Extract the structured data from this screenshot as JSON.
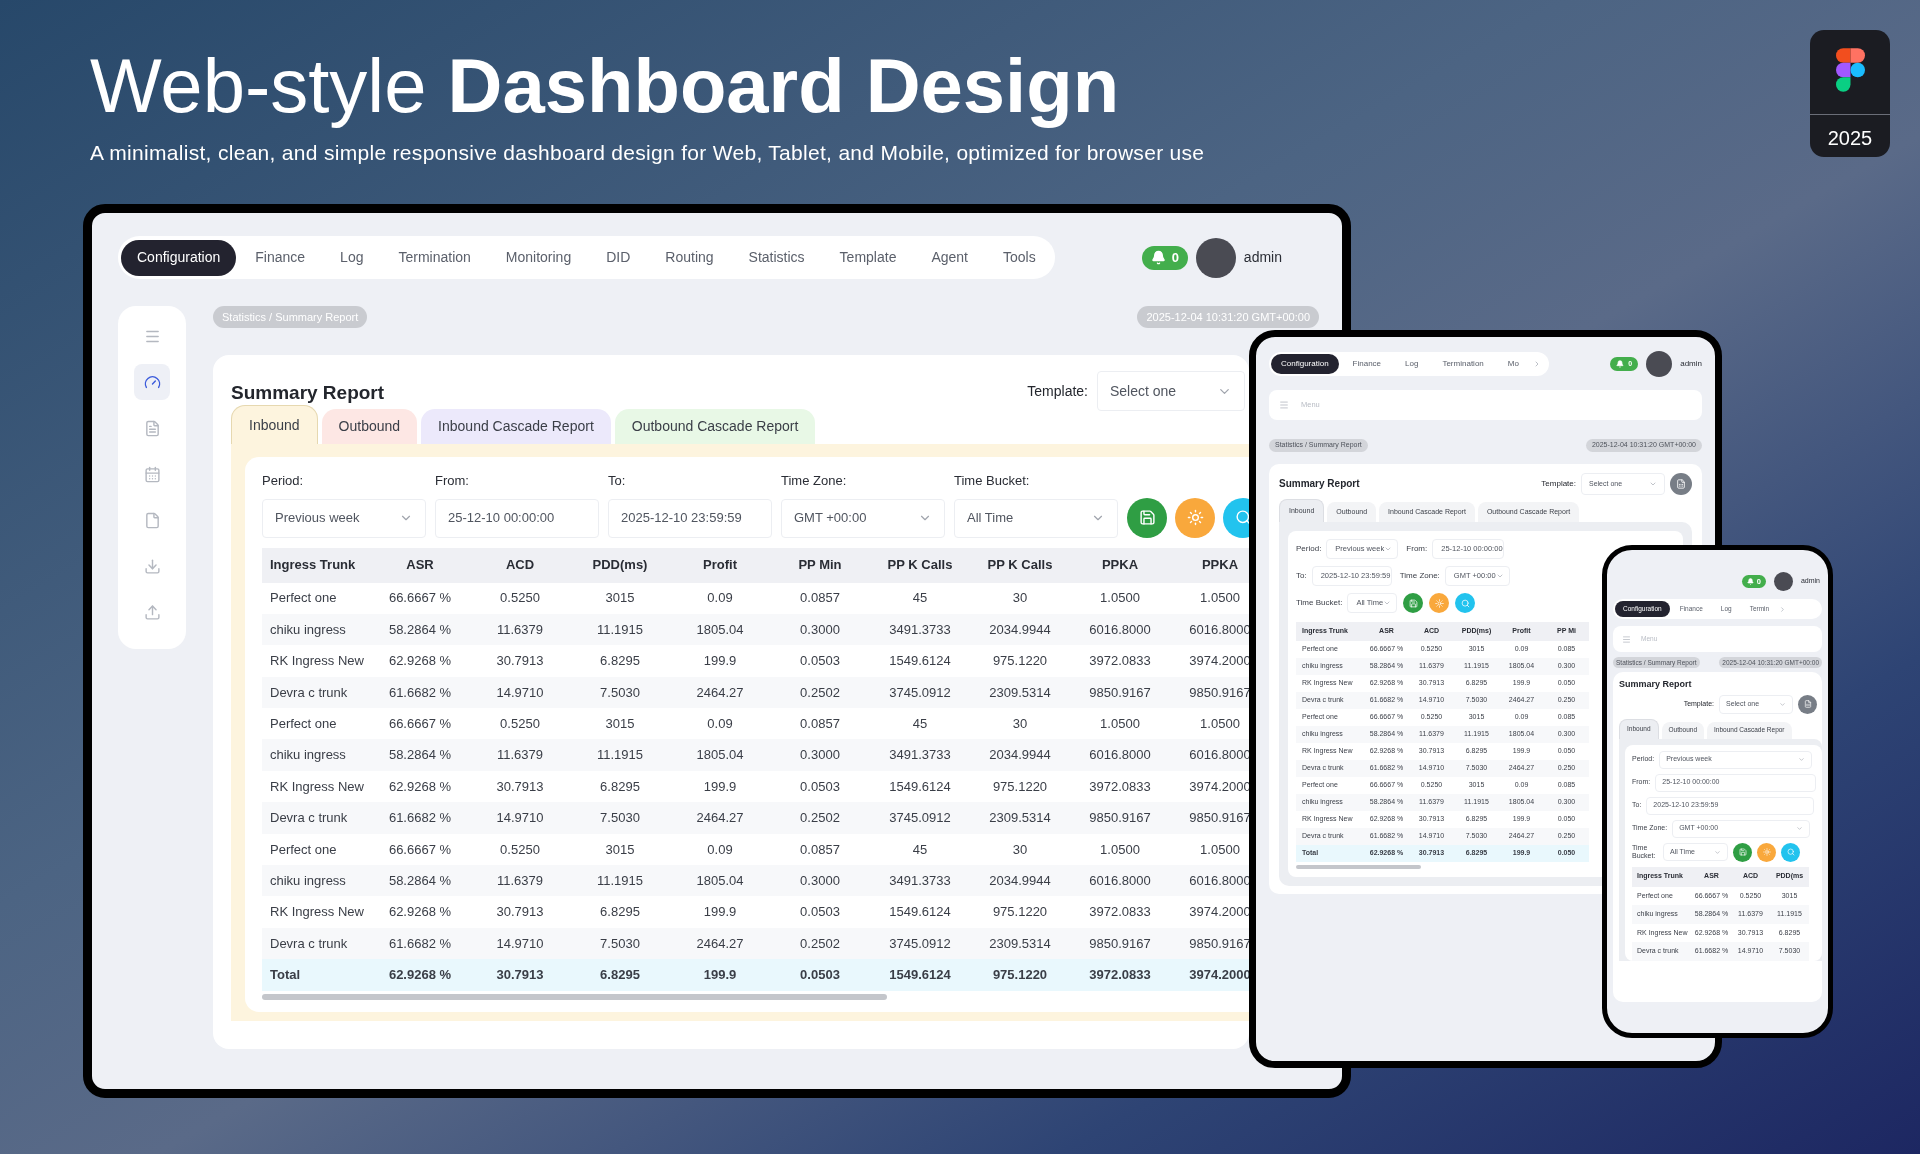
{
  "header": {
    "title_light": "Web-style",
    "title_bold": "Dashboard Design",
    "subtitle": "A minimalist, clean, and simple responsive dashboard design for Web, Tablet, and Mobile, optimized for browser use"
  },
  "badge": {
    "year": "2025"
  },
  "desktop": {
    "nav": {
      "items": [
        {
          "label": "Configuration",
          "selected": true
        },
        {
          "label": "Finance",
          "selected": false
        },
        {
          "label": "Log",
          "selected": false
        },
        {
          "label": "Termination",
          "selected": false
        },
        {
          "label": "Monitoring",
          "selected": false
        },
        {
          "label": "DID",
          "selected": false
        },
        {
          "label": "Routing",
          "selected": false
        },
        {
          "label": "Statistics",
          "selected": false
        },
        {
          "label": "Template",
          "selected": false
        },
        {
          "label": "Agent",
          "selected": false
        },
        {
          "label": "Tools",
          "selected": false
        }
      ]
    },
    "notifications": "0",
    "user": "admin",
    "sidebar": [
      {
        "kind": "menu",
        "selected": false
      },
      {
        "kind": "dashboard",
        "selected": true
      },
      {
        "kind": "report",
        "selected": false
      },
      {
        "kind": "calendar",
        "selected": false
      },
      {
        "kind": "document",
        "selected": false
      },
      {
        "kind": "download",
        "selected": false
      },
      {
        "kind": "upload",
        "selected": false
      }
    ],
    "breadcrumb": "Statistics / Summary Report",
    "timestamp": "2025-12-04 10:31:20 GMT+00:00",
    "report": {
      "title": "Summary Report",
      "template_label": "Template:",
      "template_select": "Select one",
      "tabs": [
        {
          "label": "Inbound",
          "selected": true,
          "color": "#fdf4de"
        },
        {
          "label": "Outbound",
          "selected": false,
          "color": "#fde7e4"
        },
        {
          "label": "Inbound Cascade Report",
          "selected": false,
          "color": "#ece9fb"
        },
        {
          "label": "Outbound Cascade Report",
          "selected": false,
          "color": "#e8f8e6"
        }
      ],
      "filters": [
        {
          "label": "Period:",
          "value": "Previous week",
          "kind": "select"
        },
        {
          "label": "From:",
          "value": "25-12-10 00:00:00",
          "kind": "input"
        },
        {
          "label": "To:",
          "value": "2025-12-10 23:59:59",
          "kind": "input"
        },
        {
          "label": "Time Zone:",
          "value": "GMT +00:00",
          "kind": "select"
        },
        {
          "label": "Time Bucket:",
          "value": "All Time",
          "kind": "select"
        }
      ],
      "actions": [
        {
          "kind": "save",
          "color": "#2f9e44"
        },
        {
          "kind": "brightness",
          "color": "#f9a83c"
        },
        {
          "kind": "search",
          "color": "#22c3ee"
        }
      ],
      "table": {
        "columns": [
          "Ingress Trunk",
          "ASR",
          "ACD",
          "PDD(ms)",
          "Profit",
          "PP Min",
          "PP K Calls",
          "PP K Calls",
          "PPKA",
          "PPKA"
        ],
        "rows": [
          [
            "Perfect one",
            "66.6667 %",
            "0.5250",
            "3015",
            "0.09",
            "0.0857",
            "45",
            "30",
            "1.0500",
            "1.0500"
          ],
          [
            "chiku ingress",
            "58.2864 %",
            "11.6379",
            "11.1915",
            "1805.04",
            "0.3000",
            "3491.3733",
            "2034.9944",
            "6016.8000",
            "6016.8000"
          ],
          [
            "RK Ingress New",
            "62.9268 %",
            "30.7913",
            "6.8295",
            "199.9",
            "0.0503",
            "1549.6124",
            "975.1220",
            "3972.0833",
            "3974.2000"
          ],
          [
            "Devra c trunk",
            "61.6682 %",
            "14.9710",
            "7.5030",
            "2464.27",
            "0.2502",
            "3745.0912",
            "2309.5314",
            "9850.9167",
            "9850.9167"
          ],
          [
            "Perfect one",
            "66.6667 %",
            "0.5250",
            "3015",
            "0.09",
            "0.0857",
            "45",
            "30",
            "1.0500",
            "1.0500"
          ],
          [
            "chiku ingress",
            "58.2864 %",
            "11.6379",
            "11.1915",
            "1805.04",
            "0.3000",
            "3491.3733",
            "2034.9944",
            "6016.8000",
            "6016.8000"
          ],
          [
            "RK Ingress New",
            "62.9268 %",
            "30.7913",
            "6.8295",
            "199.9",
            "0.0503",
            "1549.6124",
            "975.1220",
            "3972.0833",
            "3974.2000"
          ],
          [
            "Devra c trunk",
            "61.6682 %",
            "14.9710",
            "7.5030",
            "2464.27",
            "0.2502",
            "3745.0912",
            "2309.5314",
            "9850.9167",
            "9850.9167"
          ],
          [
            "Perfect one",
            "66.6667 %",
            "0.5250",
            "3015",
            "0.09",
            "0.0857",
            "45",
            "30",
            "1.0500",
            "1.0500"
          ],
          [
            "chiku ingress",
            "58.2864 %",
            "11.6379",
            "11.1915",
            "1805.04",
            "0.3000",
            "3491.3733",
            "2034.9944",
            "6016.8000",
            "6016.8000"
          ],
          [
            "RK Ingress New",
            "62.9268 %",
            "30.7913",
            "6.8295",
            "199.9",
            "0.0503",
            "1549.6124",
            "975.1220",
            "3972.0833",
            "3974.2000"
          ],
          [
            "Devra c trunk",
            "61.6682 %",
            "14.9710",
            "7.5030",
            "2464.27",
            "0.2502",
            "3745.0912",
            "2309.5314",
            "9850.9167",
            "9850.9167"
          ]
        ],
        "total": [
          "Total",
          "62.9268 %",
          "30.7913",
          "6.8295",
          "199.9",
          "0.0503",
          "1549.6124",
          "975.1220",
          "3972.0833",
          "3974.2000"
        ]
      }
    }
  },
  "tablet": {
    "nav": {
      "items": [
        {
          "label": "Configuration",
          "selected": true
        },
        {
          "label": "Finance",
          "selected": false
        },
        {
          "label": "Log",
          "selected": false
        },
        {
          "label": "Termination",
          "selected": false
        },
        {
          "label": "Mo",
          "selected": false
        }
      ],
      "more": true
    },
    "notifications": "0",
    "user": "admin",
    "menu": "Menu",
    "breadcrumb": "Statistics / Summary Report",
    "timestamp": "2025-12-04 10:31:20 GMT+00:00",
    "report": {
      "title": "Summary Report",
      "template_label": "Template:",
      "template_select": "Select one",
      "export": true,
      "tabs": [
        {
          "label": "Inbound",
          "selected": true
        },
        {
          "label": "Outbound",
          "selected": false
        },
        {
          "label": "Inbound Cascade Report",
          "selected": false
        },
        {
          "label": "Outbound Cascade Report",
          "selected": false
        }
      ],
      "filters": [
        {
          "label": "Period:",
          "value": "Previous week",
          "kind": "select"
        },
        {
          "label": "From:",
          "value": "25-12-10 00:00:00",
          "kind": "input"
        },
        {
          "label": "To:",
          "value": "2025-12-10 23:59:59",
          "kind": "input"
        },
        {
          "label": "Time Zone:",
          "value": "GMT +00:00",
          "kind": "select"
        },
        {
          "label": "Time Bucket:",
          "value": "All Time",
          "kind": "select"
        }
      ],
      "actions": [
        {
          "kind": "save",
          "color": "#2f9e44"
        },
        {
          "kind": "brightness",
          "color": "#f9a83c"
        },
        {
          "kind": "search",
          "color": "#22c3ee"
        }
      ],
      "table": {
        "columns": [
          "Ingress Trunk",
          "ASR",
          "ACD",
          "PDD(ms)",
          "Profit",
          "PP Mi"
        ],
        "rows": [
          [
            "Perfect one",
            "66.6667 %",
            "0.5250",
            "3015",
            "0.09",
            "0.085"
          ],
          [
            "chiku ingress",
            "58.2864 %",
            "11.6379",
            "11.1915",
            "1805.04",
            "0.300"
          ],
          [
            "RK Ingress New",
            "62.9268 %",
            "30.7913",
            "6.8295",
            "199.9",
            "0.050"
          ],
          [
            "Devra c trunk",
            "61.6682 %",
            "14.9710",
            "7.5030",
            "2464.27",
            "0.250"
          ],
          [
            "Perfect one",
            "66.6667 %",
            "0.5250",
            "3015",
            "0.09",
            "0.085"
          ],
          [
            "chiku ingress",
            "58.2864 %",
            "11.6379",
            "11.1915",
            "1805.04",
            "0.300"
          ],
          [
            "RK Ingress New",
            "62.9268 %",
            "30.7913",
            "6.8295",
            "199.9",
            "0.050"
          ],
          [
            "Devra c trunk",
            "61.6682 %",
            "14.9710",
            "7.5030",
            "2464.27",
            "0.250"
          ],
          [
            "Perfect one",
            "66.6667 %",
            "0.5250",
            "3015",
            "0.09",
            "0.085"
          ],
          [
            "chiku ingress",
            "58.2864 %",
            "11.6379",
            "11.1915",
            "1805.04",
            "0.300"
          ],
          [
            "RK Ingress New",
            "62.9268 %",
            "30.7913",
            "6.8295",
            "199.9",
            "0.050"
          ],
          [
            "Devra c trunk",
            "61.6682 %",
            "14.9710",
            "7.5030",
            "2464.27",
            "0.250"
          ]
        ],
        "total": [
          "Total",
          "62.9268 %",
          "30.7913",
          "6.8295",
          "199.9",
          "0.050"
        ]
      }
    }
  },
  "phone": {
    "nav": {
      "items": [
        {
          "label": "Configuration",
          "selected": true
        },
        {
          "label": "Finance",
          "selected": false
        },
        {
          "label": "Log",
          "selected": false
        },
        {
          "label": "Termin",
          "selected": false
        }
      ],
      "more": true
    },
    "notifications": "0",
    "user": "admin",
    "menu": "Menu",
    "breadcrumb": "Statistics / Summary Report",
    "timestamp": "2025-12-04 10:31:20 GMT+00:00",
    "report": {
      "title": "Summary Report",
      "template_label": "Template:",
      "template_select": "Select one",
      "export": true,
      "tabs": [
        {
          "label": "Inbound",
          "selected": true
        },
        {
          "label": "Outbound",
          "selected": false
        },
        {
          "label": "Inbound Cascade Repor",
          "selected": false
        }
      ],
      "filters": [
        {
          "label": "Period:",
          "value": "Previous week",
          "kind": "select"
        },
        {
          "label": "From:",
          "value": "25-12-10 00:00:00",
          "kind": "input"
        },
        {
          "label": "To:",
          "value": "2025-12-10 23:59:59",
          "kind": "input"
        },
        {
          "label": "Time Zone:",
          "value": "GMT +00:00",
          "kind": "select"
        },
        {
          "label": "Time Bucket:",
          "value": "All Time",
          "kind": "select"
        }
      ],
      "actions": [
        {
          "kind": "save",
          "color": "#2f9e44"
        },
        {
          "kind": "brightness",
          "color": "#f9a83c"
        },
        {
          "kind": "search",
          "color": "#22c3ee"
        }
      ],
      "table": {
        "columns": [
          "Ingress Trunk",
          "ASR",
          "ACD",
          "PDD(ms"
        ],
        "rows": [
          [
            "Perfect one",
            "66.6667 %",
            "0.5250",
            "3015"
          ],
          [
            "chiku ingress",
            "58.2864 %",
            "11.6379",
            "11.1915"
          ],
          [
            "RK Ingress New",
            "62.9268 %",
            "30.7913",
            "6.8295"
          ],
          [
            "Devra c trunk",
            "61.6682 %",
            "14.9710",
            "7.5030"
          ]
        ]
      }
    }
  }
}
